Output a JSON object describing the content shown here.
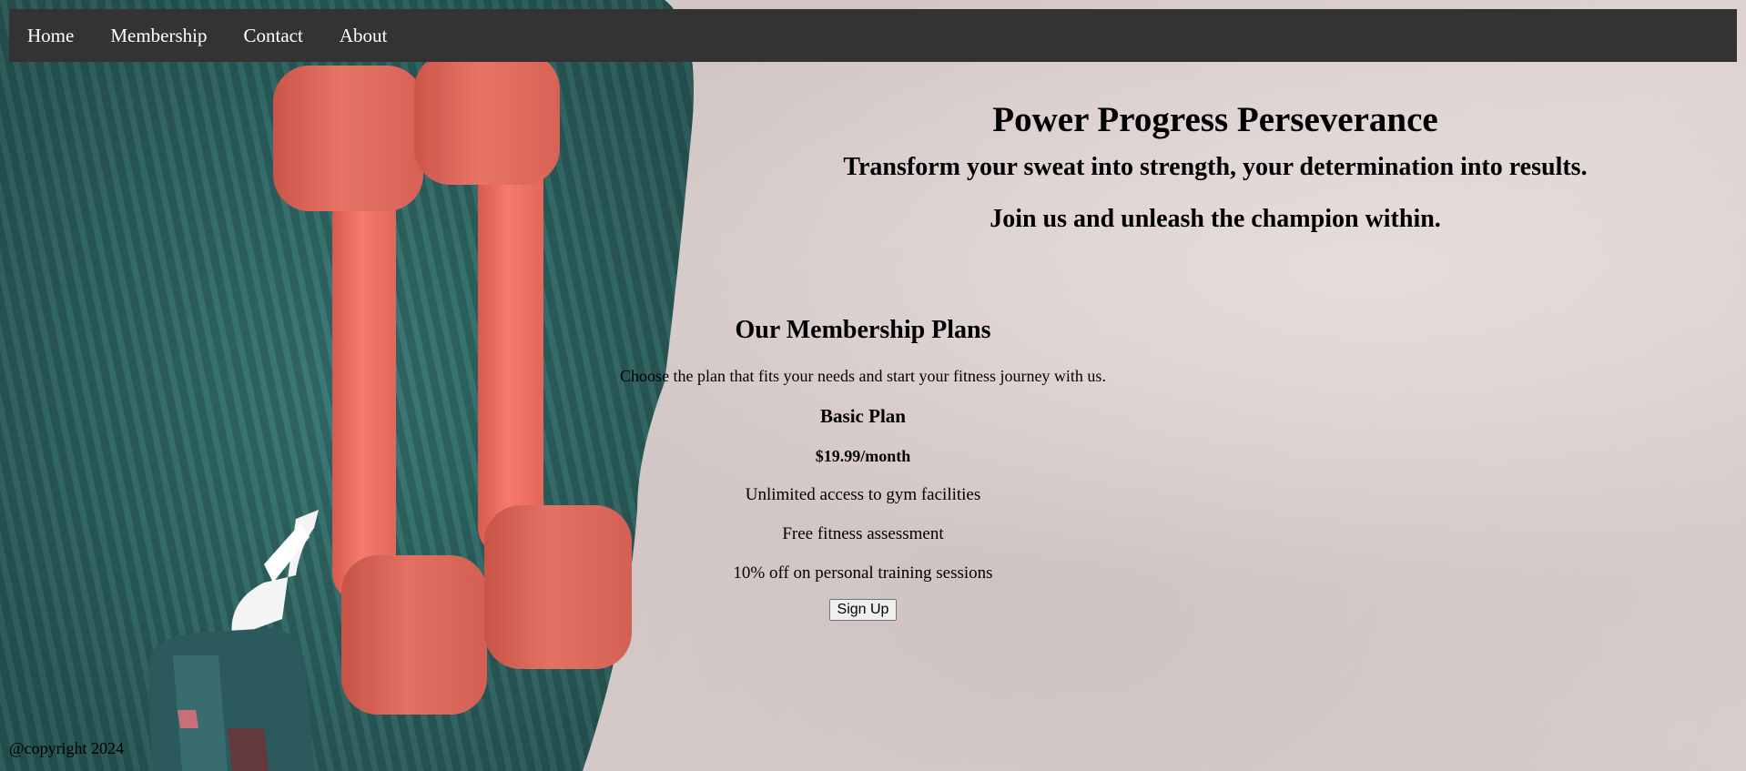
{
  "nav": {
    "items": [
      {
        "label": "Home"
      },
      {
        "label": "Membership"
      },
      {
        "label": "Contact"
      },
      {
        "label": "About"
      }
    ]
  },
  "hero": {
    "title": "Power Progress Perseverance",
    "tagline1": "Transform your sweat into strength, your determination into results.",
    "tagline2": "Join us and unleash the champion within."
  },
  "membership": {
    "heading": "Our Membership Plans",
    "intro": "Choose the plan that fits your needs and start your fitness journey with us.",
    "plans": [
      {
        "name": "Basic Plan",
        "price": "$19.99/month",
        "features": [
          "Unlimited access to gym facilities",
          "Free fitness assessment",
          "10% off on personal training sessions"
        ],
        "button_label": "Sign Up"
      }
    ]
  },
  "footer": {
    "copyright": "@copyright 2024"
  },
  "colors": {
    "navbar_bg": "#333333",
    "nav_text": "#ffffff",
    "mat": "#2f6b68",
    "dumbbell": "#f07466",
    "background": "#d7cccb"
  },
  "background_image": {
    "icon_names": [
      "yoga-mat-icon",
      "dumbbell-icon",
      "water-bottle-icon"
    ]
  }
}
